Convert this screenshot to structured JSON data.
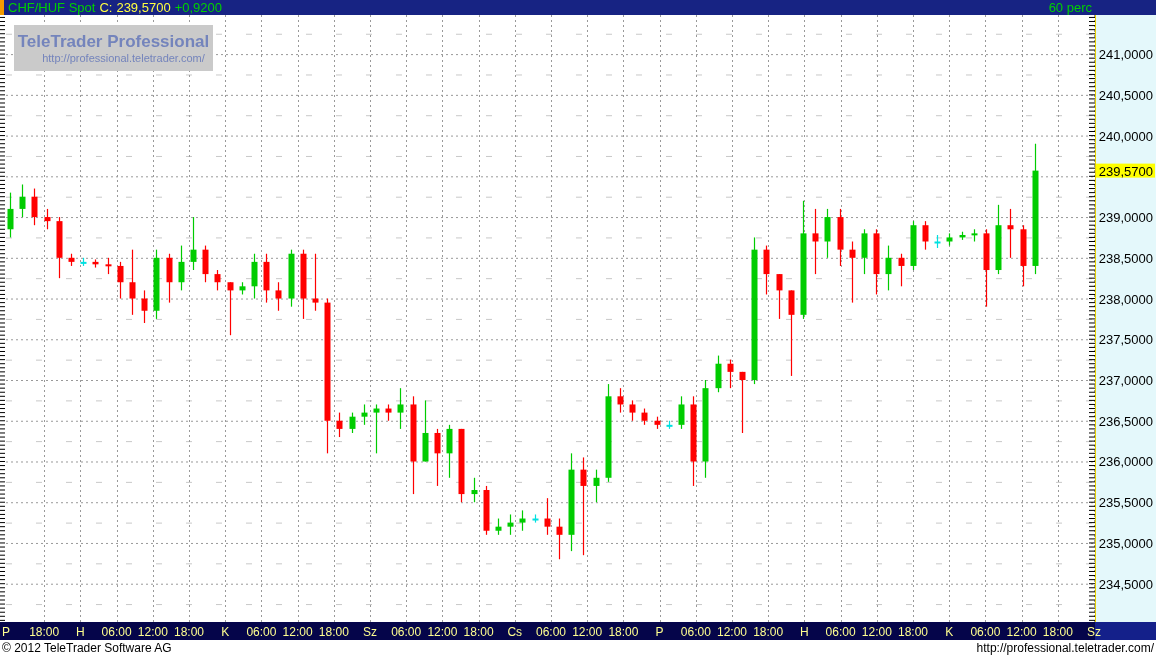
{
  "header": {
    "symbol": "CHF/HUF Spot",
    "close_label": "C:",
    "close": "239,5700",
    "change": "+0,9200",
    "period": "60 perc"
  },
  "logo": {
    "title": "TeleTrader Professional",
    "url": "http://professional.teletrader.com/"
  },
  "chart": {
    "current_price": "239,5700",
    "price_labels_above_marker": [
      "241,0000",
      "240,5000",
      "240,0000"
    ],
    "price_labels_below_marker": [
      "239,0000",
      "238,5000",
      "238,0000",
      "237,5000",
      "237,0000",
      "236,5000",
      "236,0000",
      "235,5000",
      "235,0000",
      "234,5000"
    ],
    "time_labels": [
      "P",
      "18:00",
      "H",
      "06:00",
      "12:00",
      "18:00",
      "K",
      "06:00",
      "12:00",
      "18:00",
      "Sz",
      "06:00",
      "12:00",
      "18:00",
      "Cs",
      "06:00",
      "12:00",
      "18:00",
      "P",
      "06:00",
      "12:00",
      "18:00",
      "H",
      "06:00",
      "12:00",
      "18:00",
      "K",
      "06:00",
      "12:00",
      "18:00",
      "Sz"
    ]
  },
  "footer": {
    "copyright": "© 2012 TeleTrader Software AG",
    "url": "http://professional.teletrader.com/"
  }
}
